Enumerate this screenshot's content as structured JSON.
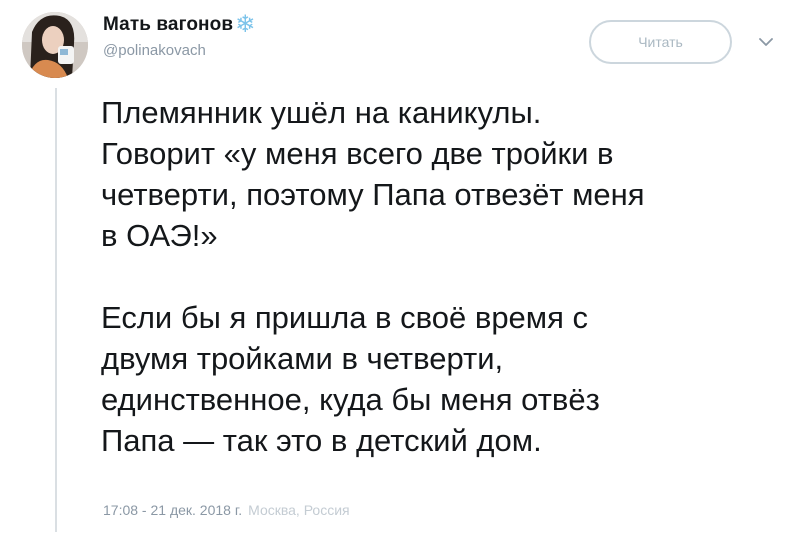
{
  "user": {
    "display_name": "Мать вагонов",
    "name_emoji": "❄",
    "handle": "@polinakovach"
  },
  "actions": {
    "follow_label": "Читать",
    "more_icon": "chevron-down-icon"
  },
  "tweet": {
    "paragraphs": [
      {
        "lines": [
          "Племянник ушёл на каникулы.",
          "Говорит «у меня всего две тройки в",
          "четверти, поэтому Папа отвезёт меня",
          "в ОАЭ!»"
        ]
      },
      {
        "lines": [
          "Если бы я пришла в своё время с",
          "двумя тройками в четверти,",
          "единственное, куда бы меня отвёз",
          "Папа — так это в детский дом."
        ]
      }
    ],
    "timestamp": "17:08 - 21 дек. 2018 г.",
    "location": "Москва, Россия"
  },
  "colors": {
    "text": "#14171a",
    "secondary": "#8b98a5",
    "snowflake": "#7cc3ea",
    "button_border": "#ccd6dd"
  }
}
